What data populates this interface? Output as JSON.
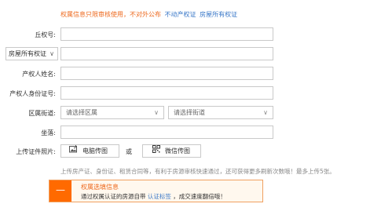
{
  "notice": {
    "text": "权属信息只限审核使用，不对外公布",
    "links": [
      "不动产权证",
      "房屋所有权证"
    ]
  },
  "form": {
    "cert_no_label": "丘权号:",
    "cert_type_selected": "房屋所有权证",
    "owner_name_label": "产权人姓名:",
    "owner_id_label": "产权人身份证号:",
    "district_label": "区属街道:",
    "district_placeholder": "请选择区属",
    "street_placeholder": "请选择街道",
    "address_label": "坐落:",
    "upload_label": "上传证件照片:",
    "upload_pc": "电脑传图",
    "or": "或",
    "upload_wechat": "微信传图",
    "hint": "上传房产证、身份证、租赁合同等，有利于房源审核快速通过，还可获得更多刷新次数哦！最多上传5张。"
  },
  "tip": {
    "icon": "minus-icon",
    "title": "权属选填信息",
    "body_prefix": "通过权属认证的房源自带",
    "body_link": "认证标签",
    "body_suffix": "，成交速度翻倍哦！"
  }
}
